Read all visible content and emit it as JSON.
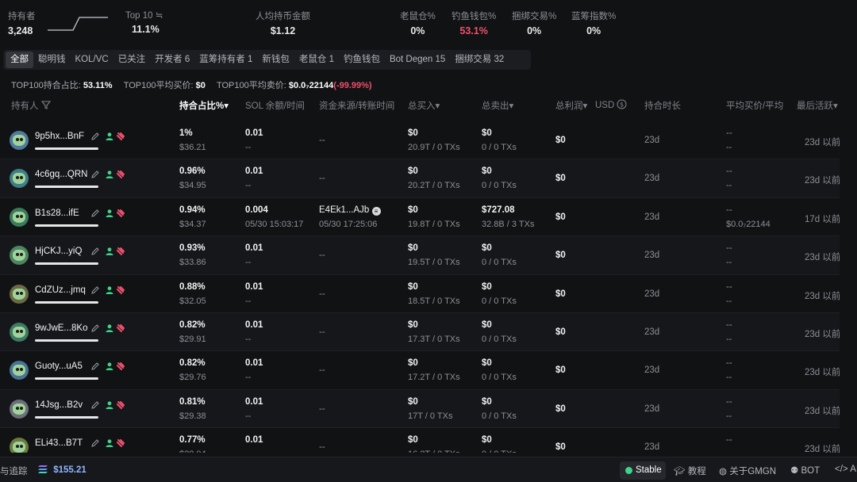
{
  "stats": {
    "holders": {
      "label": "持有者",
      "value": "3,248"
    },
    "top10": {
      "label": "Top 10 ≒",
      "value": "11.1%"
    },
    "avg_amount": {
      "label": "人均持币金额",
      "value": "$1.12"
    },
    "rat": {
      "label": "老鼠仓%",
      "value": "0%"
    },
    "phishing": {
      "label": "钓鱼钱包%",
      "value": "53.1%"
    },
    "bundle": {
      "label": "捆绑交易%",
      "value": "0%"
    },
    "bluechip": {
      "label": "蓝筹指数%",
      "value": "0%"
    }
  },
  "tabs": [
    "全部",
    "聪明钱",
    "KOL/VC",
    "已关注",
    "开发者 6",
    "蓝筹持有者 1",
    "新钱包",
    "老鼠仓 1",
    "钓鱼钱包",
    "Bot Degen 15",
    "捆绑交易 32"
  ],
  "summary": {
    "l1": "TOP100持合占比:",
    "v1": "53.11%",
    "l2": "TOP100平均买价:",
    "v2": "$0",
    "l3": "TOP100平均卖价:",
    "v3": "$0.0₇22144",
    "v3b": "(-99.99%)"
  },
  "headers": {
    "holder": "持有人",
    "pct": "持合占比%",
    "sol": "SOL 余额/时间",
    "source": "资金来源/转账时间",
    "buy": "总买入",
    "sell": "总卖出",
    "pnl": "总利润",
    "usd": "USD",
    "hold": "持合时长",
    "avg": "平均买价/平均",
    "last": "最后活跃"
  },
  "rows": [
    {
      "addr": "9p5hx...BnF",
      "pct": "1%",
      "usd": "$36.21",
      "sol": "0.01",
      "sol_t": "--",
      "src": "--",
      "src_t": "",
      "buy": "$0",
      "buy_s": "20.9T / 0 TXs",
      "sell": "$0",
      "sell_s": "0 / 0 TXs",
      "pnl": "$0",
      "hold": "23d",
      "avg1": "--",
      "avg2": "--",
      "last": "23d 以前"
    },
    {
      "addr": "4c6gq...QRN",
      "pct": "0.96%",
      "usd": "$34.95",
      "sol": "0.01",
      "sol_t": "--",
      "src": "--",
      "src_t": "",
      "buy": "$0",
      "buy_s": "20.2T / 0 TXs",
      "sell": "$0",
      "sell_s": "0 / 0 TXs",
      "pnl": "$0",
      "hold": "23d",
      "avg1": "--",
      "avg2": "--",
      "last": "23d 以前"
    },
    {
      "addr": "B1s28...ifE",
      "pct": "0.94%",
      "usd": "$34.37",
      "sol": "0.004",
      "sol_t": "05/30 15:03:17",
      "src": "E4Ek1...AJb",
      "src_t": "05/30 17:25:06",
      "buy": "$0",
      "buy_s": "19.8T / 0 TXs",
      "sell": "$727.08",
      "sell_s": "32.8B / 3 TXs",
      "pnl": "$0",
      "hold": "23d",
      "avg1": "--",
      "avg2": "$0.0₇22144",
      "last": "17d 以前"
    },
    {
      "addr": "HjCKJ...yiQ",
      "pct": "0.93%",
      "usd": "$33.86",
      "sol": "0.01",
      "sol_t": "--",
      "src": "--",
      "src_t": "",
      "buy": "$0",
      "buy_s": "19.5T / 0 TXs",
      "sell": "$0",
      "sell_s": "0 / 0 TXs",
      "pnl": "$0",
      "hold": "23d",
      "avg1": "--",
      "avg2": "--",
      "last": "23d 以前"
    },
    {
      "addr": "CdZUz...jmq",
      "pct": "0.88%",
      "usd": "$32.05",
      "sol": "0.01",
      "sol_t": "--",
      "src": "--",
      "src_t": "",
      "buy": "$0",
      "buy_s": "18.5T / 0 TXs",
      "sell": "$0",
      "sell_s": "0 / 0 TXs",
      "pnl": "$0",
      "hold": "23d",
      "avg1": "--",
      "avg2": "--",
      "last": "23d 以前"
    },
    {
      "addr": "9wJwE...8Ko",
      "pct": "0.82%",
      "usd": "$29.91",
      "sol": "0.01",
      "sol_t": "--",
      "src": "--",
      "src_t": "",
      "buy": "$0",
      "buy_s": "17.3T / 0 TXs",
      "sell": "$0",
      "sell_s": "0 / 0 TXs",
      "pnl": "$0",
      "hold": "23d",
      "avg1": "--",
      "avg2": "--",
      "last": "23d 以前"
    },
    {
      "addr": "Guoty...uA5",
      "pct": "0.82%",
      "usd": "$29.76",
      "sol": "0.01",
      "sol_t": "--",
      "src": "--",
      "src_t": "",
      "buy": "$0",
      "buy_s": "17.2T / 0 TXs",
      "sell": "$0",
      "sell_s": "0 / 0 TXs",
      "pnl": "$0",
      "hold": "23d",
      "avg1": "--",
      "avg2": "--",
      "last": "23d 以前"
    },
    {
      "addr": "14Jsg...B2v",
      "pct": "0.81%",
      "usd": "$29.38",
      "sol": "0.01",
      "sol_t": "--",
      "src": "--",
      "src_t": "",
      "buy": "$0",
      "buy_s": "17T / 0 TXs",
      "sell": "$0",
      "sell_s": "0 / 0 TXs",
      "pnl": "$0",
      "hold": "23d",
      "avg1": "--",
      "avg2": "--",
      "last": "23d 以前"
    },
    {
      "addr": "ELi43...B7T",
      "pct": "0.77%",
      "usd": "$28.04",
      "sol": "0.01",
      "sol_t": "--",
      "src": "--",
      "src_t": "",
      "buy": "$0",
      "buy_s": "16.2T / 0 TXs",
      "sell": "$0",
      "sell_s": "0 / 0 TXs",
      "pnl": "$0",
      "hold": "23d",
      "avg1": "--",
      "avg2": "--",
      "last": "23d 以前"
    }
  ],
  "bottom": {
    "tracker": "与追踪",
    "sol_price": "$155.21",
    "stable": "Stable",
    "tutorial": "教程",
    "about": "关于GMGN",
    "bot": "BOT",
    "api": "AI"
  },
  "colors": {
    "accent_red": "#f0506e",
    "accent_green": "#3ed58a",
    "background": "#111214"
  }
}
